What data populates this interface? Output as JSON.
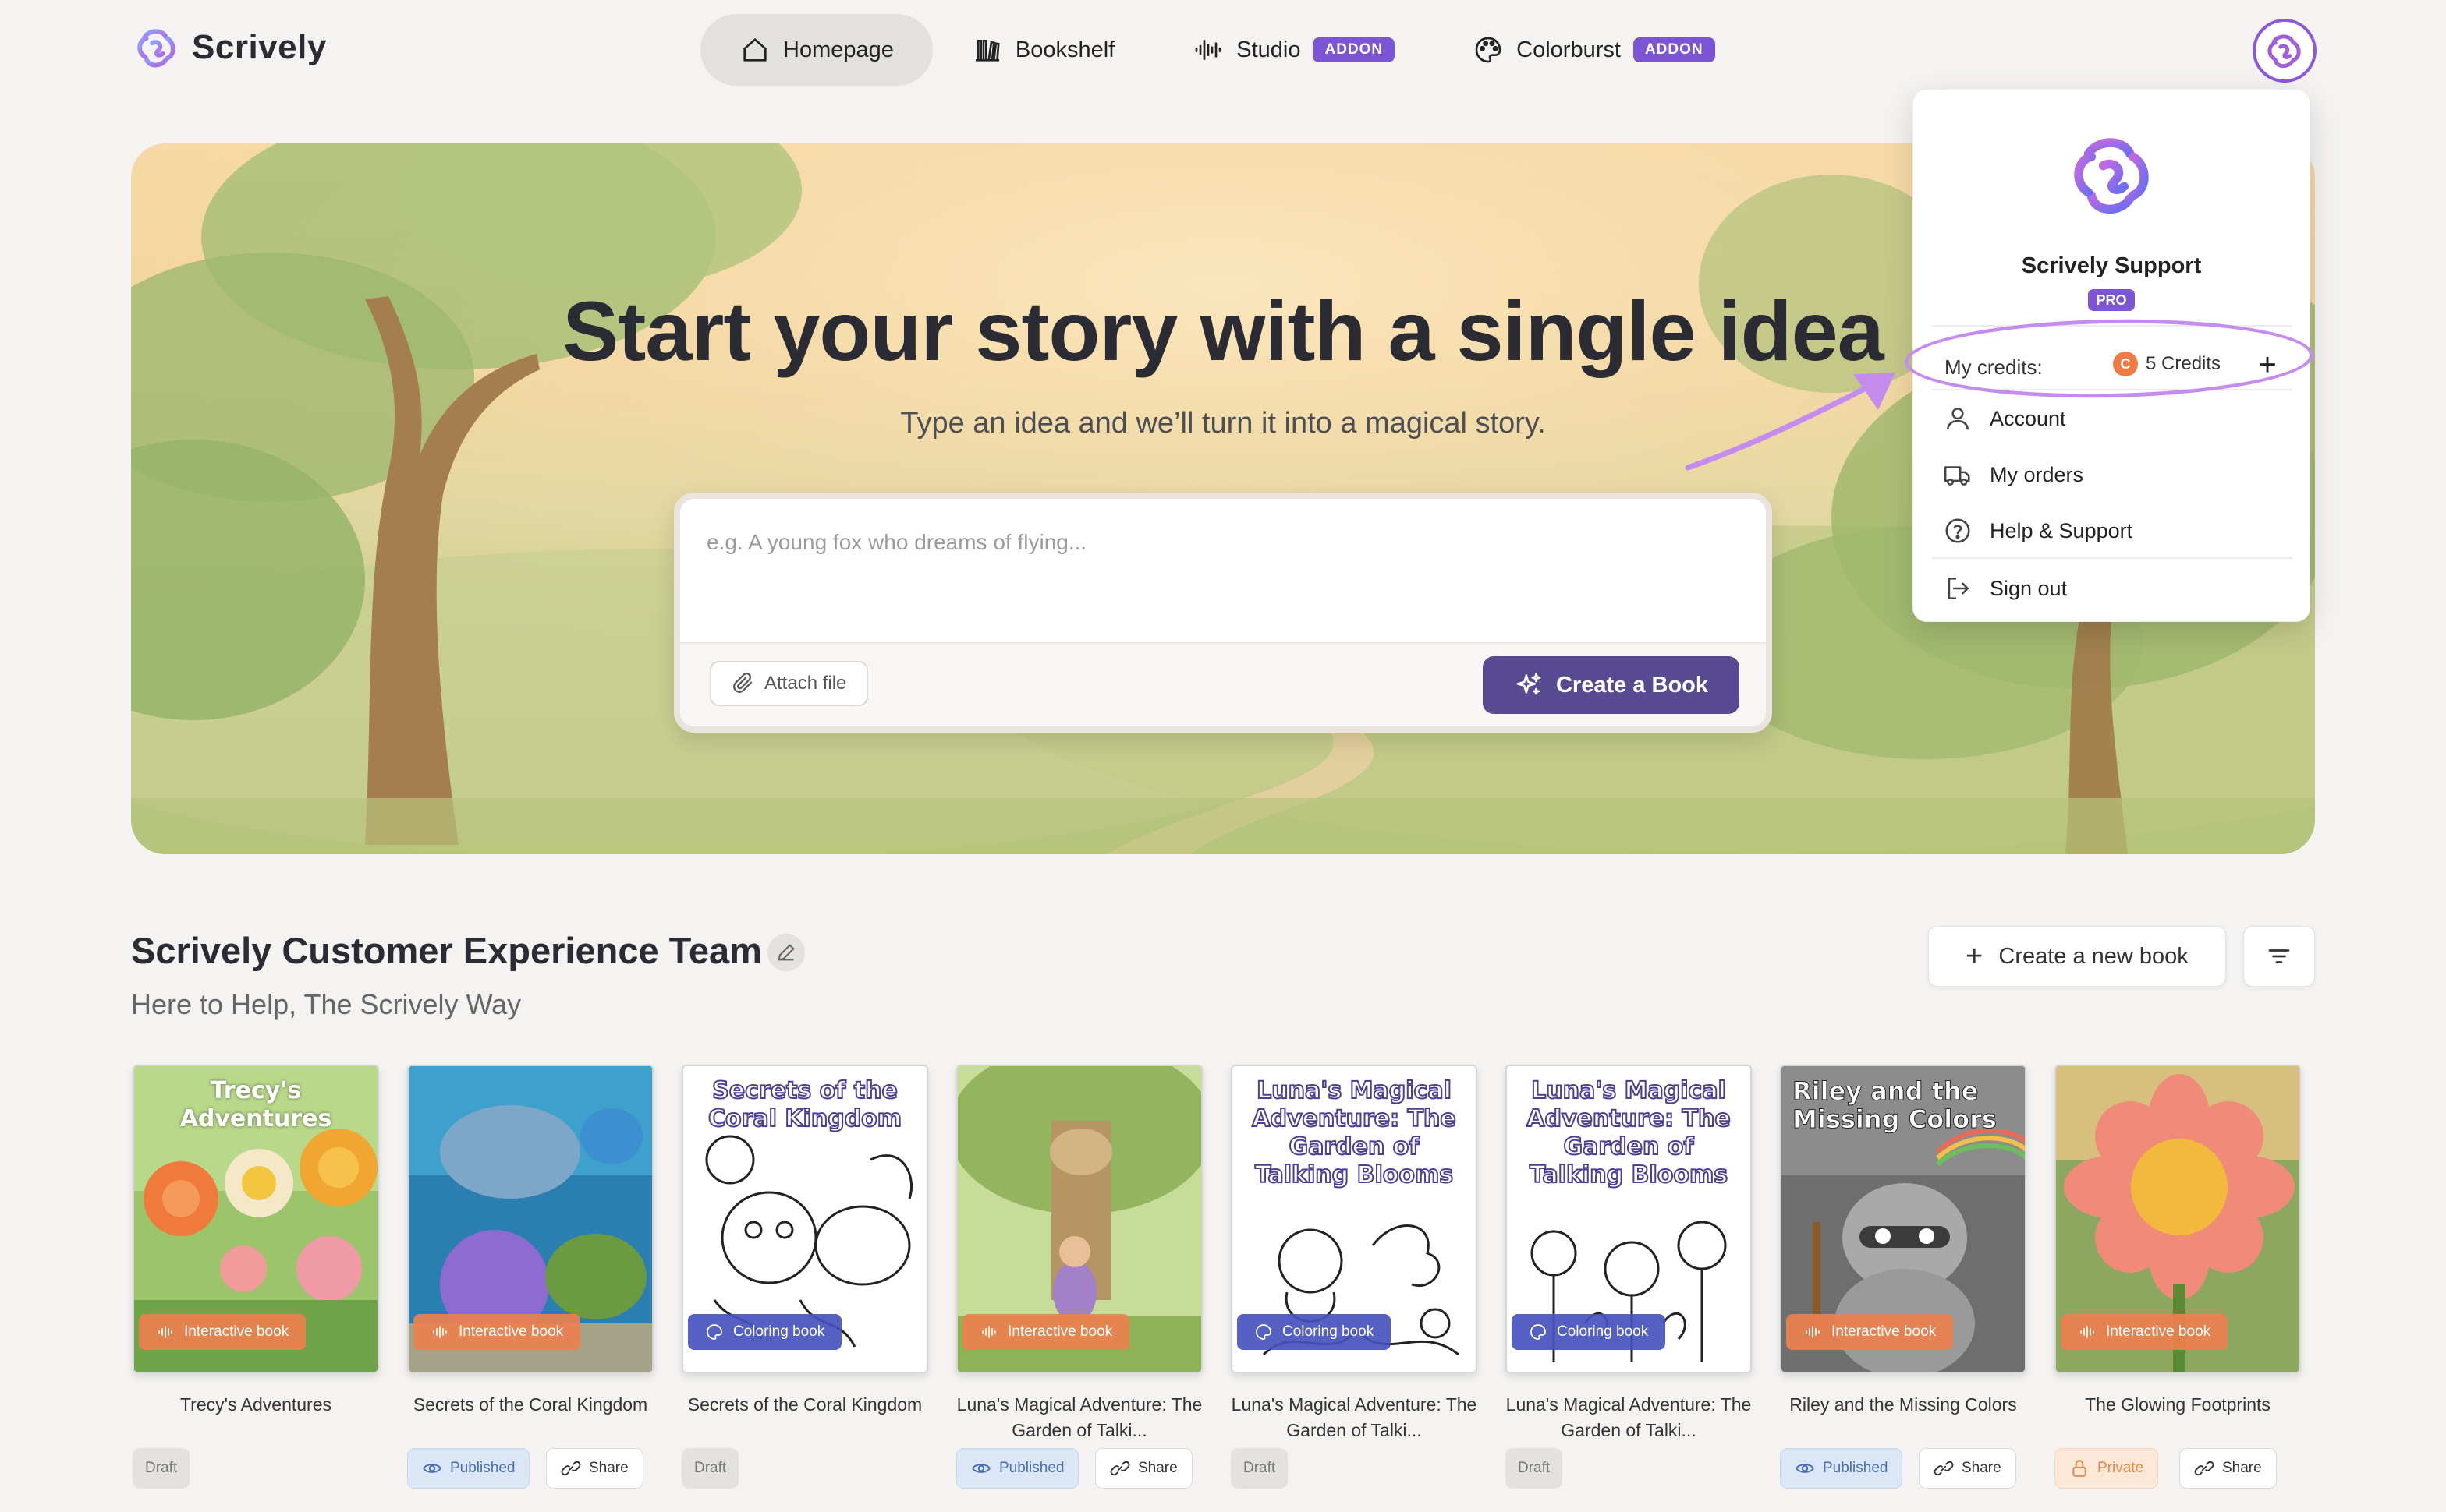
{
  "app": {
    "name": "Scrively"
  },
  "nav": {
    "items": [
      {
        "label": "Homepage",
        "icon": "home-icon",
        "active": true
      },
      {
        "label": "Bookshelf",
        "icon": "books-icon"
      },
      {
        "label": "Studio",
        "icon": "audio-wave-icon",
        "badge": "ADDON"
      },
      {
        "label": "Colorburst",
        "icon": "palette-icon",
        "badge": "ADDON"
      }
    ]
  },
  "hero": {
    "title": "Start your story with a single idea",
    "subtitle": "Type an idea and we’ll turn it into a magical story.",
    "placeholder": "e.g. A young fox who dreams of flying...",
    "attach_label": "Attach file",
    "create_label": "Create a Book"
  },
  "dropdown": {
    "user_name": "Scrively Support",
    "plan_badge": "PRO",
    "credits_label": "My credits:",
    "credits_coin": "C",
    "credits_value": "5 Credits",
    "add_symbol": "+",
    "items": [
      {
        "label": "Account",
        "icon": "user-icon"
      },
      {
        "label": "My orders",
        "icon": "truck-icon"
      },
      {
        "label": "Help & Support",
        "icon": "help-circle-icon"
      },
      {
        "label": "Sign out",
        "icon": "sign-out-icon"
      }
    ]
  },
  "team": {
    "title": "Scrively Customer Experience Team",
    "subtitle": "Here to Help, The Scrively Way",
    "new_book_label": "Create a new book",
    "new_book_plus": "+"
  },
  "books": [
    {
      "title": "Trecy's Adventures",
      "cover_title": "Trecy's Adventures",
      "type": "Interactive book",
      "status": "Draft",
      "share": ""
    },
    {
      "title": "Secrets of the Coral Kingdom",
      "cover_title": "",
      "type": "Interactive book",
      "status": "Published",
      "share": "Share"
    },
    {
      "title": "Secrets of the Coral Kingdom",
      "cover_title": "Secrets of the Coral Kingdom",
      "type": "Coloring book",
      "status": "Draft",
      "share": ""
    },
    {
      "title": "Luna's Magical Adventure: The Garden of Talki...",
      "cover_title": "",
      "type": "Interactive book",
      "status": "Published",
      "share": "Share"
    },
    {
      "title": "Luna's Magical Adventure: The Garden of Talki...",
      "cover_title": "Luna's Magical Adventure: The Garden of Talking Blooms",
      "type": "Coloring book",
      "status": "Draft",
      "share": ""
    },
    {
      "title": "Luna's Magical Adventure: The Garden of Talki...",
      "cover_title": "Luna's Magical Adventure: The Garden of Talking Blooms",
      "type": "Coloring book",
      "status": "Draft",
      "share": ""
    },
    {
      "title": "Riley and the Missing Colors",
      "cover_title": "Riley and the Missing Colors",
      "type": "Interactive book",
      "status": "Published",
      "share": "Share"
    },
    {
      "title": "The Glowing Footprints",
      "cover_title": "",
      "type": "Interactive book",
      "status": "Private",
      "share": "Share"
    }
  ],
  "colors": {
    "accent": "#7c55d6",
    "create_button": "#574a90",
    "interactive_chip": "#ec804e",
    "coloring_chip": "#4652be",
    "annotation": "#c58cef"
  }
}
